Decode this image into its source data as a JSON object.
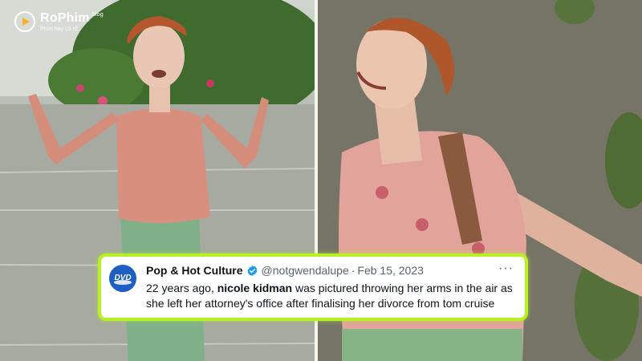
{
  "watermark": {
    "brand": "RoPhim",
    "tld": ".blog",
    "tagline": "Phim hay cả rổ"
  },
  "photos": [
    {
      "icon": "photo-woman-arms-raised-street"
    },
    {
      "icon": "photo-woman-arms-out-closeup"
    }
  ],
  "tweet": {
    "author_name": "Pop & Hot Culture",
    "handle": "@notgwendalupe",
    "separator": "·",
    "date": "Feb 15, 2023",
    "more_label": "···",
    "body": {
      "p1": "22 years ago, ",
      "b1": "nicole kidman",
      "p2": " was pictured throwing her arms in the air as she left her attorney's office after finalising her divorce from tom cruise"
    },
    "avatar_text": "DVD",
    "accent": "#b7f025",
    "verified_color": "#1d9bf0"
  }
}
